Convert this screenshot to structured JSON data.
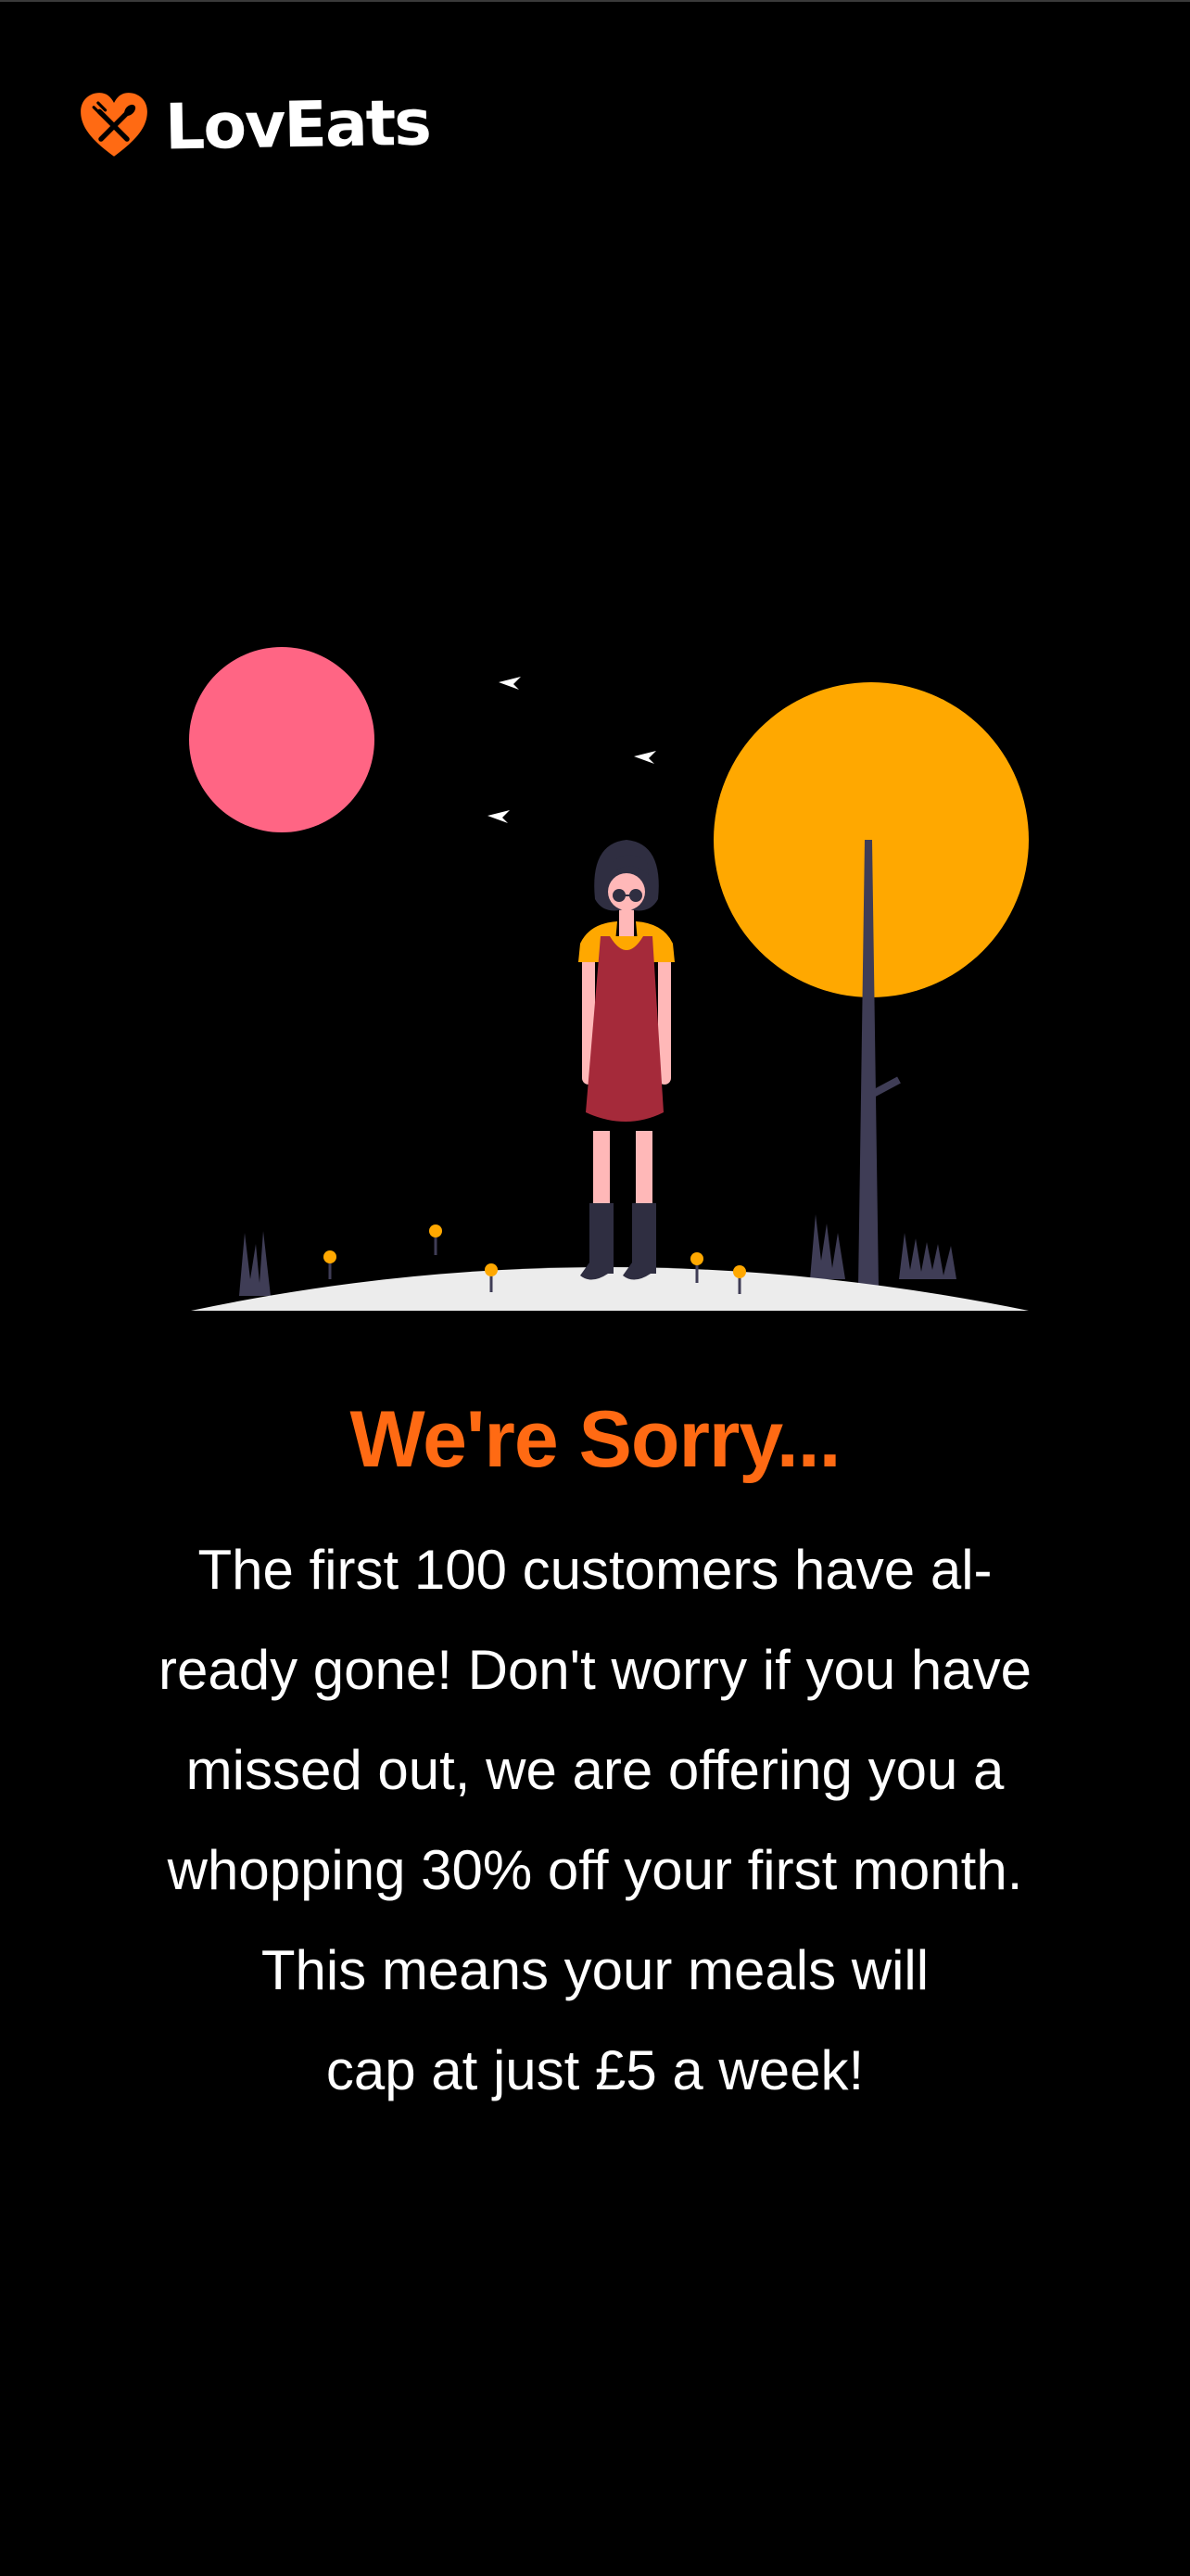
{
  "brand": {
    "name": "LovEats",
    "color": "#ff6a13"
  },
  "page": {
    "headline": "We're Sorry...",
    "message_lines": [
      "The first 100 customers have al-",
      "ready gone! Don't worry if you have",
      "missed out, we are offering you a",
      "whopping 30% off your first month.",
      "This means your meals will",
      "cap at just £5 a week!"
    ]
  },
  "illustration": {
    "icon": "woman-standing-on-hill-at-night-illustration",
    "colors": {
      "moon_pink": "#ff6584",
      "sun_orange": "#ffa800",
      "dress": "#a52a3a",
      "hill": "#ececec"
    }
  }
}
